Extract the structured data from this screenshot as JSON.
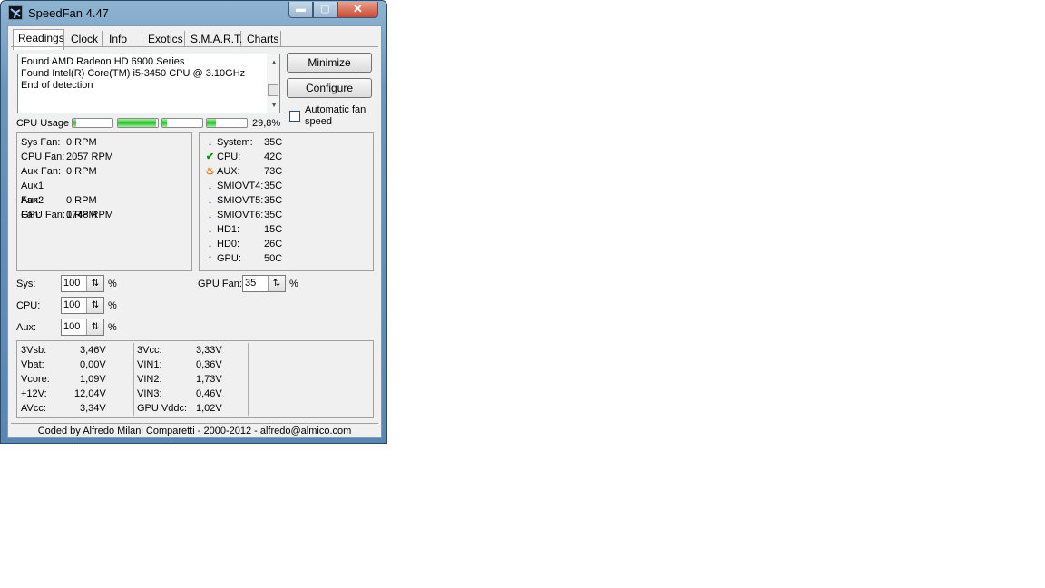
{
  "window": {
    "title": "SpeedFan 4.47",
    "min_glyph": "▬",
    "max_glyph": "▢",
    "close_glyph": "✕"
  },
  "tabs": [
    {
      "label": "Readings"
    },
    {
      "label": "Clock"
    },
    {
      "label": "Info"
    },
    {
      "label": "Exotics"
    },
    {
      "label": "S.M.A.R.T."
    },
    {
      "label": "Charts"
    }
  ],
  "log": {
    "lines": [
      "Found AMD Radeon HD 6900 Series",
      "Found Intel(R) Core(TM) i5-3450 CPU @ 3.10GHz",
      "End of detection"
    ]
  },
  "buttons": {
    "minimize": "Minimize",
    "configure": "Configure"
  },
  "auto_fan": {
    "label": "Automatic fan speed",
    "checked": false
  },
  "cpu_usage": {
    "label": "CPU Usage",
    "total": "29,8%",
    "cores": [
      0.08,
      0.95,
      0.12,
      0.22
    ]
  },
  "fans": [
    {
      "label": "Sys Fan:",
      "value": "0 RPM"
    },
    {
      "label": "CPU Fan:",
      "value": "2057 RPM"
    },
    {
      "label": "Aux Fan:",
      "value": "0 RPM"
    },
    {
      "label": "Aux1 Fan:",
      "value": "0 RPM"
    },
    {
      "label": "Aux2 Fan:",
      "value": "0 RPM"
    },
    {
      "label": "GPU Fan:",
      "value": "1748 RPM"
    }
  ],
  "temps": [
    {
      "icon": "arrow-down-icon",
      "glyph": "↓",
      "label": "System:",
      "value": "35C"
    },
    {
      "icon": "check-icon",
      "glyph": "✔",
      "label": "CPU:",
      "value": "42C"
    },
    {
      "icon": "flame-icon",
      "glyph": "♨",
      "label": "AUX:",
      "value": "73C"
    },
    {
      "icon": "arrow-down-icon",
      "glyph": "↓",
      "label": "SMIOVT4:",
      "value": "35C"
    },
    {
      "icon": "arrow-down-icon",
      "glyph": "↓",
      "label": "SMIOVT5:",
      "value": "35C"
    },
    {
      "icon": "arrow-down-icon",
      "glyph": "↓",
      "label": "SMIOVT6:",
      "value": "35C"
    },
    {
      "icon": "arrow-down-icon",
      "glyph": "↓",
      "label": "HD1:",
      "value": "15C"
    },
    {
      "icon": "arrow-down-icon",
      "glyph": "↓",
      "label": "HD0:",
      "value": "26C"
    },
    {
      "icon": "arrow-up-icon",
      "glyph": "↑",
      "label": "GPU:",
      "value": "50C"
    }
  ],
  "speeds": {
    "sys": {
      "label": "Sys:",
      "value": "100",
      "unit": "%"
    },
    "cpu": {
      "label": "CPU:",
      "value": "100",
      "unit": "%"
    },
    "aux": {
      "label": "Aux:",
      "value": "100",
      "unit": "%"
    },
    "gpu": {
      "label": "GPU Fan:",
      "value": "35",
      "unit": "%"
    },
    "spin_glyph": "⇅"
  },
  "voltages_left": [
    {
      "label": "3Vsb:",
      "value": "3,46V"
    },
    {
      "label": "Vbat:",
      "value": "0,00V"
    },
    {
      "label": "Vcore:",
      "value": "1,09V"
    },
    {
      "label": "+12V:",
      "value": "12,04V"
    },
    {
      "label": "AVcc:",
      "value": "3,34V"
    }
  ],
  "voltages_right": [
    {
      "label": "3Vcc:",
      "value": "3,33V"
    },
    {
      "label": "VIN1:",
      "value": "0,36V"
    },
    {
      "label": "VIN2:",
      "value": "1,73V"
    },
    {
      "label": "VIN3:",
      "value": "0,46V"
    },
    {
      "label": "GPU Vddc:",
      "value": "1,02V"
    }
  ],
  "status": "Coded by Alfredo Milani Comparetti - 2000-2012 - alfredo@almico.com",
  "colors": {
    "bar_fill": "#2dc12d",
    "arrow_down": "#1020c0",
    "check": "#109010",
    "flame": "#e07010",
    "arrow_up": "#e01010"
  }
}
